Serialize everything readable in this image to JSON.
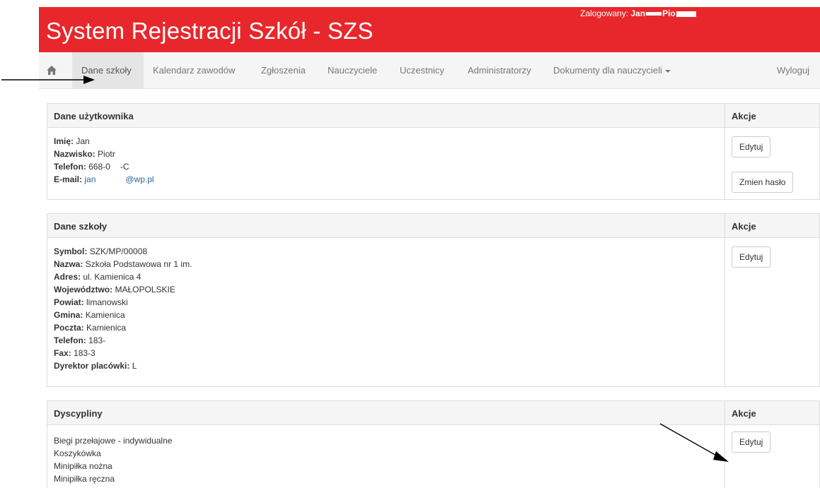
{
  "header": {
    "title": "System Rejestracji Szkół - SZS",
    "login_prefix": "Zalogowany: ",
    "login_name_a": "Jan",
    "login_name_b": "Pio"
  },
  "nav": {
    "items": [
      {
        "label": "Dane szkoły"
      },
      {
        "label": "Kalendarz zawodów"
      },
      {
        "label": "Zgłoszenia"
      },
      {
        "label": "Nauczyciele"
      },
      {
        "label": "Uczestnicy"
      },
      {
        "label": "Administratorzy"
      },
      {
        "label": "Dokumenty dla nauczycieli"
      }
    ],
    "logout": "Wyloguj"
  },
  "user_panel": {
    "header_left": "Dane użytkownika",
    "header_right": "Akcje",
    "imie_label": "Imię:",
    "imie_value": "Jan",
    "nazwisko_label": "Nazwisko:",
    "nazwisko_value": "Piotr",
    "telefon_label": "Telefon:",
    "telefon_value": "668-0",
    "telefon_tail": "-C",
    "email_label": "E-mail:",
    "email_user": "jan",
    "email_domain": "@wp.pl",
    "edit_button": "Edytuj",
    "change_password_button": "Zmien hasło"
  },
  "school_panel": {
    "header_left": "Dane szkoły",
    "header_right": "Akcje",
    "symbol_label": "Symbol:",
    "symbol_value": "SZK/MP/00008",
    "nazwa_label": "Nazwa:",
    "nazwa_value": "Szkoła Podstawowa nr 1 im.",
    "adres_label": "Adres:",
    "adres_value": "ul. Kamienica 4",
    "woj_label": "Województwo:",
    "woj_value": "MAŁOPOLSKIE",
    "powiat_label": "Powiat:",
    "powiat_value": "limanowski",
    "gmina_label": "Gmina:",
    "gmina_value": "Kamienica",
    "poczta_label": "Poczta:",
    "poczta_value": "Kamienica",
    "telefon_label": "Telefon:",
    "telefon_value": "183-",
    "fax_label": "Fax:",
    "fax_value": "183-3",
    "dyrektor_label": "Dyrektor placówki:",
    "dyrektor_value": "L",
    "edit_button": "Edytuj"
  },
  "disciplines_panel": {
    "header_left": "Dyscypliny",
    "header_right": "Akcje",
    "items": [
      "Biegi przełajowe - indywidualne",
      "Koszykówka",
      "Minipiłka nożna",
      "Minipiłka ręczna"
    ],
    "edit_button": "Edytuj"
  },
  "colors": {
    "brand_red": "#e8272c",
    "navbar_bg": "#f5f5f5",
    "panel_head_bg": "#f5f5f5",
    "link": "#2a6496"
  },
  "icons": {
    "home": "home-icon",
    "caret": "caret-down-icon",
    "arrow": "annotation-arrow"
  }
}
